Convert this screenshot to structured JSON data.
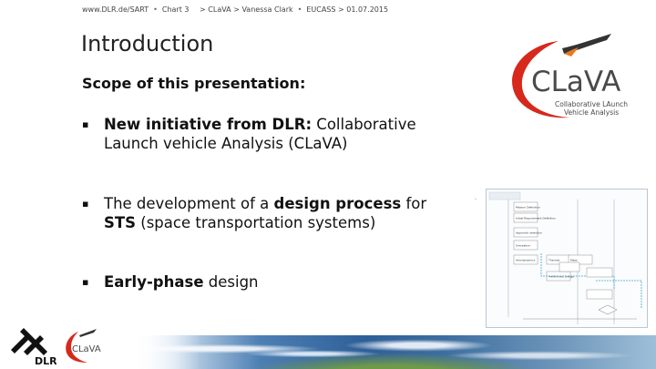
{
  "header": {
    "url": "www.DLR.de/SART",
    "chart": "Chart 3",
    "project": "> CLaVA",
    "author": "> Vanessa Clark",
    "event": "EUCASS",
    "date": "> 01.07.2015",
    "separator": "•"
  },
  "slide": {
    "title": "Introduction",
    "subtitle": "Scope of this presentation:",
    "bullet_marker": "▪",
    "bullets": [
      {
        "bold": "New initiative from DLR:",
        "text": " Collaborative Launch vehicle Analysis (CLaVA)"
      },
      {
        "pre": "The development of a ",
        "bold": "design process",
        "mid": " for ",
        "bold2": "STS",
        "text": " (space transportation systems)"
      },
      {
        "bold": "Early-phase",
        "text": " design"
      }
    ]
  },
  "logo": {
    "wordmark": "CLaVA",
    "tagline_1": "Collaborative LAunch",
    "tagline_2": "Vehicle Analysis",
    "small_wordmark": "CLaVA",
    "dlr": "DLR",
    "brand_red": "#d7281c",
    "brand_gray": "#4a4a4a"
  },
  "diagram": {
    "steps": [
      "Mission Definition",
      "Initial Requirement Definition",
      "Approach selection",
      "Simulation",
      "Aerodynamics",
      "Thermal",
      "Mass",
      "Preliminary Design"
    ],
    "accent": "#3aa6c8"
  },
  "colors": {
    "footer_blue": "#2f5f97"
  }
}
